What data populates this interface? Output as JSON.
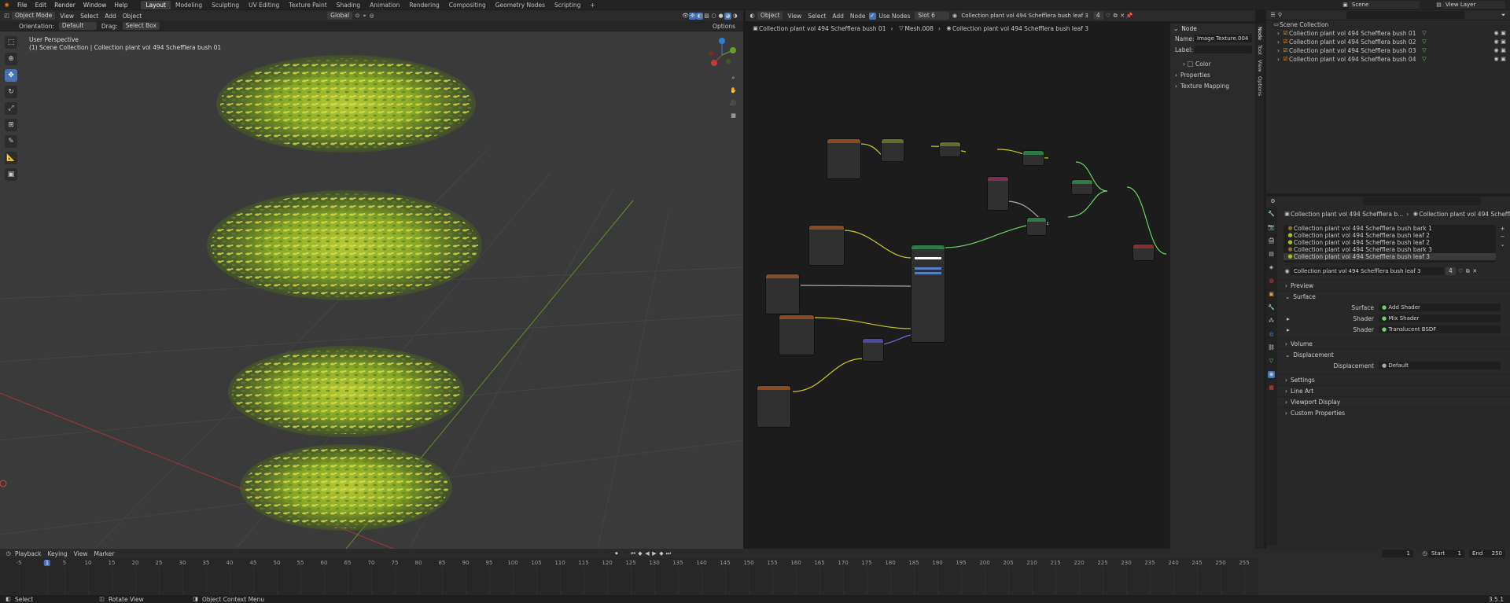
{
  "topbar": {
    "menus": [
      "File",
      "Edit",
      "Render",
      "Window",
      "Help"
    ],
    "workspaces": [
      "Layout",
      "Modeling",
      "Sculpting",
      "UV Editing",
      "Texture Paint",
      "Shading",
      "Animation",
      "Rendering",
      "Compositing",
      "Geometry Nodes",
      "Scripting",
      "+"
    ],
    "active_workspace": "Layout",
    "scene": "Scene",
    "view_layer": "View Layer"
  },
  "viewport": {
    "mode": "Object Mode",
    "menus": [
      "View",
      "Select",
      "Add",
      "Object"
    ],
    "orientation_label": "Orientation:",
    "orientation_value": "Default",
    "drag_label": "Drag:",
    "drag_value": "Select Box",
    "transform": "Global",
    "options_label": "Options",
    "overlay_title": "User Perspective",
    "overlay_subtitle": "(1) Scene Collection | Collection plant vol 494 Schefflera bush 01",
    "gizmo_axes": [
      "Z",
      "Y",
      "X"
    ],
    "tools": [
      "select-box",
      "cursor",
      "move",
      "rotate",
      "scale",
      "transform",
      "annotate",
      "measure",
      "add-cube"
    ]
  },
  "node_editor": {
    "editor_type": "Object",
    "menus": [
      "View",
      "Select",
      "Add",
      "Node"
    ],
    "use_nodes_label": "Use Nodes",
    "slot": "Slot 6",
    "material": "Collection plant vol 494 Schefflera bush leaf 3",
    "user_count": "4",
    "breadcrumb": [
      "Collection plant vol 494 Schefflera bush 01",
      "Mesh.008",
      "Collection plant vol 494 Schefflera bush leaf 3"
    ],
    "node_panel": {
      "section": "Node",
      "name_label": "Name:",
      "name_value": "Image Texture.004",
      "label_label": "Label:",
      "label_value": "",
      "color_label": "Color",
      "properties_label": "Properties",
      "texture_mapping_label": "Texture Mapping"
    },
    "side_tabs": [
      "Node",
      "Tool",
      "View",
      "Options"
    ]
  },
  "outliner": {
    "root": "Scene Collection",
    "items": [
      "Collection plant vol 494 Schefflera bush 01",
      "Collection plant vol 494 Schefflera bush 02",
      "Collection plant vol 494 Schefflera bush 03",
      "Collection plant vol 494 Schefflera bush 04"
    ]
  },
  "properties": {
    "breadcrumb_object": "Collection plant vol 494 Schefflera b...",
    "breadcrumb_material": "Collection plant vol 494 Schefflera bush...",
    "material_slots": [
      "Collection plant vol 494 Schefflera bush bark 1",
      "Collection plant vol 494 Schefflera bush leaf 2",
      "Collection plant vol 494 Schefflera bush leaf 2",
      "Collection plant vol 494 Schefflera bush bark 3",
      "Collection plant vol 494 Schefflera bush leaf 3"
    ],
    "active_material": "Collection plant vol 494 Schefflera bush leaf 3",
    "material_users": "4",
    "sections": {
      "preview": "Preview",
      "surface": "Surface",
      "volume": "Volume",
      "displacement": "Displacement",
      "settings": "Settings",
      "line_art": "Line Art",
      "viewport_display": "Viewport Display",
      "custom_properties": "Custom Properties"
    },
    "surface_label": "Surface",
    "surface_value": "Add Shader",
    "shader_label": "Shader",
    "shader1": "Mix Shader",
    "shader2": "Translucent BSDF",
    "displacement_label": "Displacement",
    "displacement_value": "Default"
  },
  "timeline": {
    "menus": [
      "Playback",
      "Keying",
      "View",
      "Marker"
    ],
    "current_frame": "1",
    "start_label": "Start",
    "start_value": "1",
    "end_label": "End",
    "end_value": "250",
    "ticks": [
      "-5",
      "1",
      "5",
      "10",
      "15",
      "20",
      "25",
      "30",
      "35",
      "40",
      "45",
      "50",
      "55",
      "60",
      "65",
      "70",
      "75",
      "80",
      "85",
      "90",
      "95",
      "100",
      "105",
      "110",
      "115",
      "120",
      "125",
      "130",
      "135",
      "140",
      "145",
      "150",
      "155",
      "160",
      "165",
      "170",
      "175",
      "180",
      "185",
      "190",
      "195",
      "200",
      "205",
      "210",
      "215",
      "220",
      "225",
      "230",
      "235",
      "240",
      "245",
      "250",
      "255"
    ]
  },
  "status": {
    "select": "Select",
    "rotate": "Rotate View",
    "context": "Object Context Menu",
    "version": "3.5.1"
  },
  "colors": {
    "accent": "#4772b3",
    "foliage": "#9fbf2a",
    "x_axis": "#c0393b",
    "y_axis": "#6b9e2a",
    "z_axis": "#2f7fd1"
  }
}
